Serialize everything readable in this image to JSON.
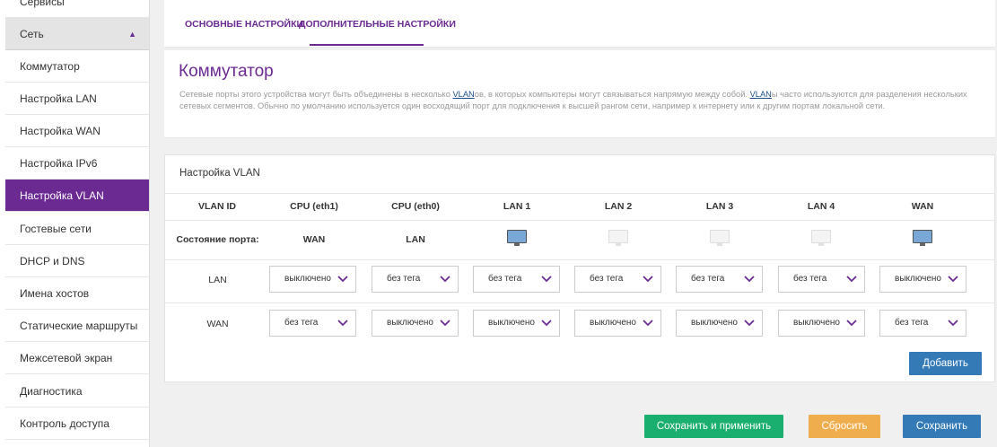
{
  "sidebar": {
    "items": [
      {
        "label": "Сервисы"
      },
      {
        "label": "Сеть"
      },
      {
        "label": "Коммутатор"
      },
      {
        "label": "Настройка LAN"
      },
      {
        "label": "Настройка WAN"
      },
      {
        "label": "Настройка IPv6"
      },
      {
        "label": "Настройка VLAN"
      },
      {
        "label": "Гостевые сети"
      },
      {
        "label": "DHCP и DNS"
      },
      {
        "label": "Имена хостов"
      },
      {
        "label": "Статические маршруты"
      },
      {
        "label": "Межсетевой экран"
      },
      {
        "label": "Диагностика"
      },
      {
        "label": "Контроль доступа"
      }
    ]
  },
  "tabs": [
    {
      "label": "ОСНОВНЫЕ НАСТРОЙКИ"
    },
    {
      "label": "ДОПОЛНИТЕЛЬНЫЕ НАСТРОЙКИ"
    }
  ],
  "info": {
    "title": "Коммутатор",
    "text_1": "Сетевые порты этого устройства могут быть объединены в несколько ",
    "link_1": "VLAN",
    "text_2": "ов, в которых компьютеры могут связываться напрямую между собой. ",
    "link_2": "VLAN",
    "text_3": "ы часто используются для разделения нескольких сетевых сегментов. Обычно по умолчанию используется один восходящий порт для подключения к высшей рангом сети, например к интернету или к другим портам локальной сети."
  },
  "vlan": {
    "title": "Настройка VLAN",
    "columns": [
      "VLAN ID",
      "CPU (eth1)",
      "CPU (eth0)",
      "LAN 1",
      "LAN 2",
      "LAN 3",
      "LAN 4",
      "WAN"
    ],
    "port_state": {
      "label": "Состояние порта:",
      "cpu_eth1": "WAN",
      "cpu_eth0": "LAN",
      "lan1": "connected",
      "lan2": "disconnected",
      "lan3": "disconnected",
      "lan4": "disconnected",
      "wan": "connected"
    },
    "rows": [
      {
        "id": "LAN",
        "values": [
          "выключено",
          "без тега",
          "без тега",
          "без тега",
          "без тега",
          "без тега",
          "выключено"
        ]
      },
      {
        "id": "WAN",
        "values": [
          "без тега",
          "выключено",
          "выключено",
          "выключено",
          "выключено",
          "выключено",
          "без тега"
        ]
      }
    ],
    "add_label": "Добавить"
  },
  "footer": {
    "save_apply": "Сохранить и применить",
    "reset": "Сбросить",
    "save": "Сохранить"
  },
  "colors": {
    "accent": "#6b2a92",
    "primary": "#337ab7",
    "success": "#1aae6f",
    "warning": "#f0ad4e"
  }
}
